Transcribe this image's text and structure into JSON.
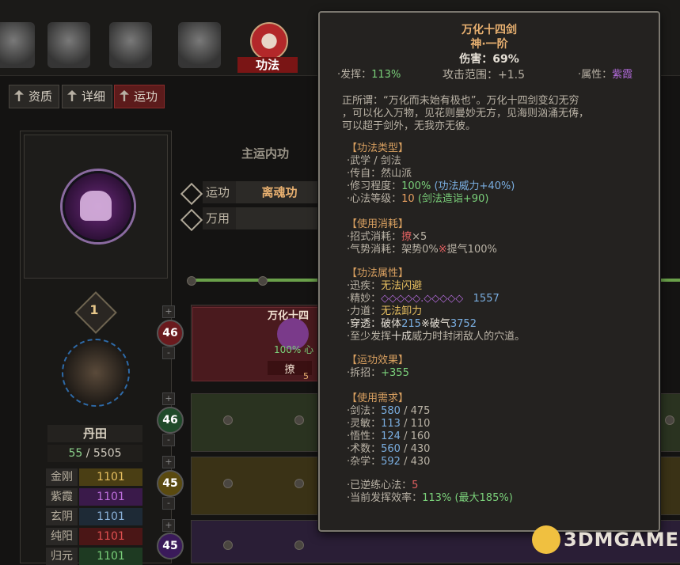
{
  "topbar": {
    "active_tab_label": "功法"
  },
  "subtabs": [
    {
      "label": "资质",
      "active": false
    },
    {
      "label": "详细",
      "active": false
    },
    {
      "label": "运功",
      "active": true
    }
  ],
  "center": {
    "main_section_title": "主运内功",
    "rows": [
      {
        "label": "运功",
        "value": "离魂功"
      },
      {
        "label": "万用",
        "value": ""
      }
    ]
  },
  "left": {
    "level": "1",
    "dantian_label": "丹田",
    "dantian_current": "55",
    "dantian_sep": " / ",
    "dantian_max": "5505",
    "attrs": [
      {
        "name": "金刚",
        "value": "1101",
        "color": "#e8c060"
      },
      {
        "name": "紫霞",
        "value": "1101",
        "color": "#c070e0"
      },
      {
        "name": "玄阴",
        "value": "1101",
        "color": "#8ab0d8"
      },
      {
        "name": "纯阳",
        "value": "1101",
        "color": "#e05050"
      },
      {
        "name": "归元",
        "value": "1101",
        "color": "#7ad07a"
      }
    ]
  },
  "side_numbers": [
    {
      "value": "46",
      "bg": "#6a1a1e",
      "sign": "-"
    },
    {
      "value": "46",
      "bg": "#1f4a2a",
      "sign": "-"
    },
    {
      "value": "45",
      "bg": "#5a4a10",
      "sign": "-"
    },
    {
      "value": "45",
      "bg": "#3a1a5a",
      "sign": ""
    }
  ],
  "skill_card": {
    "name": "万化十四",
    "pct": "100% 心",
    "tag": "撩",
    "num": "5"
  },
  "tooltip": {
    "name": "万化十四剑",
    "rank": "神·一阶",
    "damage": "伤害：69%",
    "fahui_label": "·发挥：",
    "fahui_value": "113%",
    "range": "攻击范围：+1.5",
    "attr_label": "·属性：",
    "attr_value": "紫霞",
    "desc1": "正所谓：“万化而未始有极也”。万化十四剑变幻无穷",
    "desc2": "，可以化入万物，见花则曼妙无方，见海则汹涌无俦，",
    "desc3": "可以超于剑外，无我亦无彼。",
    "sec_type": "【功法类型】",
    "type_line1": "·武学 / 剑法",
    "type_line2": "·传自：然山派",
    "xiuxi_label": "·修习程度：",
    "xiuxi_value": "100%",
    "xiuxi_extra": "(功法威力+40%)",
    "xinfa_label": "·心法等级：",
    "xinfa_value": "10",
    "xinfa_extra": "(剑法造诣+90)",
    "sec_cost": "【使用消耗】",
    "cost1_label": "·招式消耗：",
    "cost1_value": "撩",
    "cost1_count": "×5",
    "cost2_label": "·气势消耗：架势0%",
    "cost2_sep": "※",
    "cost2_rest": "提气100%",
    "sec_props": "【功法属性】",
    "p1_label": "·迅疾：",
    "p1_value": "无法闪避",
    "p2_label": "·精妙：",
    "p2_value": "◇◇◇◇◇.◇◇◇◇◇",
    "p2_num": "1557",
    "p3_label": "·力道：",
    "p3_value": "无法卸力",
    "p4_label": "·穿透：破体",
    "p4_v1": "215",
    "p4_mid": "※破气",
    "p4_v2": "3752",
    "p5_a": "·至少发挥",
    "p5_b": "十成",
    "p5_c": "威力时封闭敌人的穴道。",
    "sec_effect": "【运功效果】",
    "eff_label": "·拆招：",
    "eff_value": "+355",
    "sec_req": "【使用需求】",
    "req": [
      {
        "label": "·剑法：",
        "cur": "580",
        "max": "475"
      },
      {
        "label": "·灵敏：",
        "cur": "113",
        "max": "110"
      },
      {
        "label": "·悟性：",
        "cur": "124",
        "max": "160"
      },
      {
        "label": "·术数：",
        "cur": "560",
        "max": "430"
      },
      {
        "label": "·杂学：",
        "cur": "592",
        "max": "430"
      }
    ],
    "reverse_label": "·已逆练心法：",
    "reverse_value": "5",
    "eff_rate_label": "·当前发挥效率：",
    "eff_rate_value": "113%",
    "eff_rate_max": "(最大185%)"
  },
  "watermark": "3DMGAME"
}
